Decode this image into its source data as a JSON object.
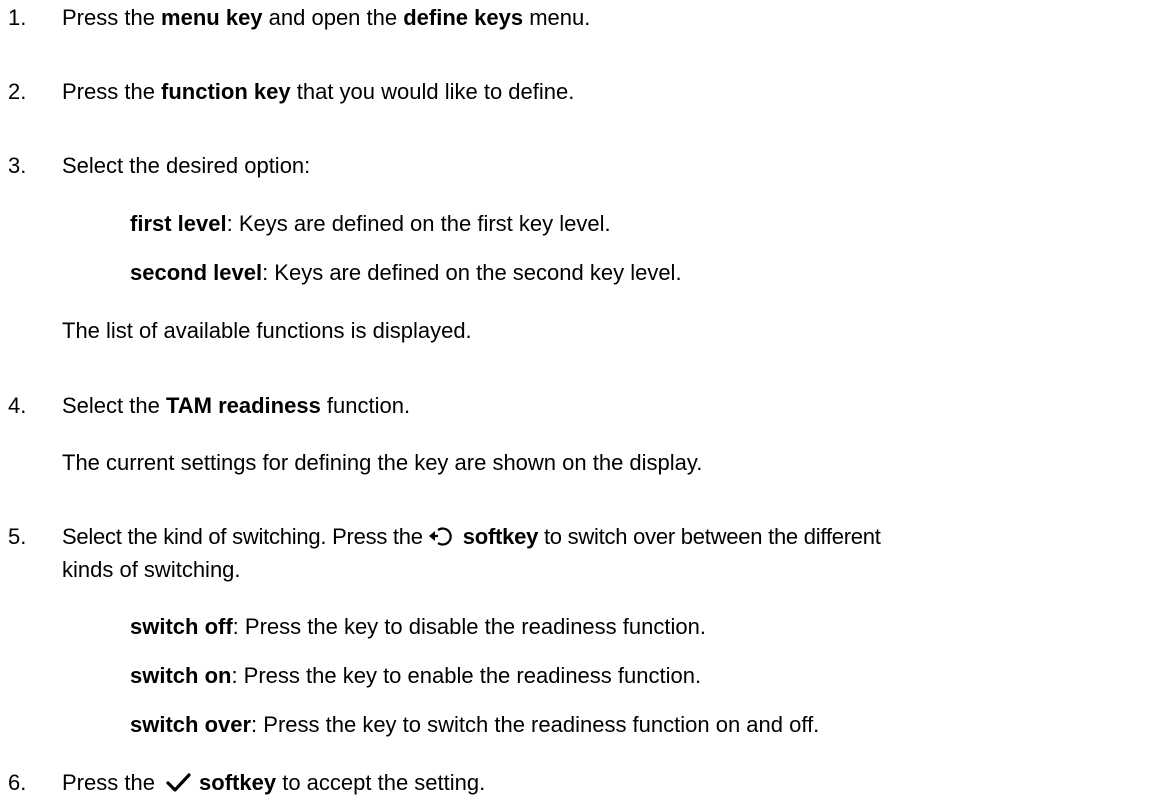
{
  "steps": [
    {
      "number": "1.",
      "parts": [
        "Press the ",
        "menu key",
        " and open the ",
        "define keys",
        " menu."
      ]
    },
    {
      "number": "2.",
      "parts": [
        "Press the ",
        "function key",
        " that you would like to define."
      ]
    },
    {
      "number": "3.",
      "text": "Select the desired option:",
      "options": [
        {
          "term": "first level",
          "desc": ": Keys are defined on the first key level."
        },
        {
          "term": "second level",
          "desc": ": Keys are defined on the second key level."
        }
      ],
      "note": "The list of available functions is displayed."
    },
    {
      "number": "4.",
      "parts": [
        "Select the ",
        "TAM readiness",
        " function."
      ],
      "note": "The current settings for defining the key are shown on the display."
    },
    {
      "number": "5.",
      "line1_pre": "Select the kind of switching. Press the",
      "line1_key": "softkey",
      "line1_post": " to switch over between the different",
      "line2": "kinds of switching.",
      "icon": "switch-over-softkey-icon",
      "options": [
        {
          "term": "switch off",
          "desc": ": Press the key to disable the readiness function."
        },
        {
          "term": "switch on",
          "desc": ": Press the key to enable the readiness function."
        },
        {
          "term": "switch over",
          "desc": ": Press the key to switch the readiness function on and off."
        }
      ]
    },
    {
      "number": "6.",
      "pre": "Press the ",
      "key": "softkey",
      "post": " to accept the setting.",
      "icon": "checkmark-softkey-icon"
    }
  ]
}
